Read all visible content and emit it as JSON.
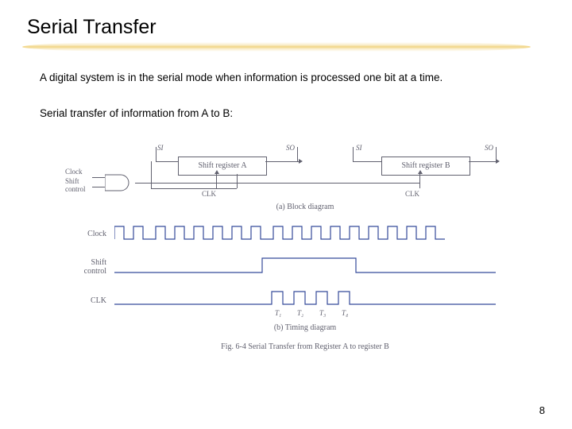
{
  "title": "Serial Transfer",
  "para1": "A digital system is in the serial mode when information is processed one bit at a time.",
  "para2": "Serial transfer of information from A to B:",
  "block": {
    "regA": "Shift register A",
    "regB": "Shift register B",
    "si": "SI",
    "so": "SO",
    "clk": "CLK",
    "clock": "Clock",
    "shift": "Shift\ncontrol",
    "captionA": "(a) Block diagram"
  },
  "timing": {
    "clock": "Clock",
    "shiftControl": "Shift\ncontrol",
    "clk": "CLK",
    "t1": "T₁",
    "t2": "T₂",
    "t3": "T₃",
    "t4": "T₄",
    "captionB": "(b) Timing diagram"
  },
  "figCaption": "Fig. 6-4  Serial Transfer from Register A to register B",
  "pageNumber": "8"
}
